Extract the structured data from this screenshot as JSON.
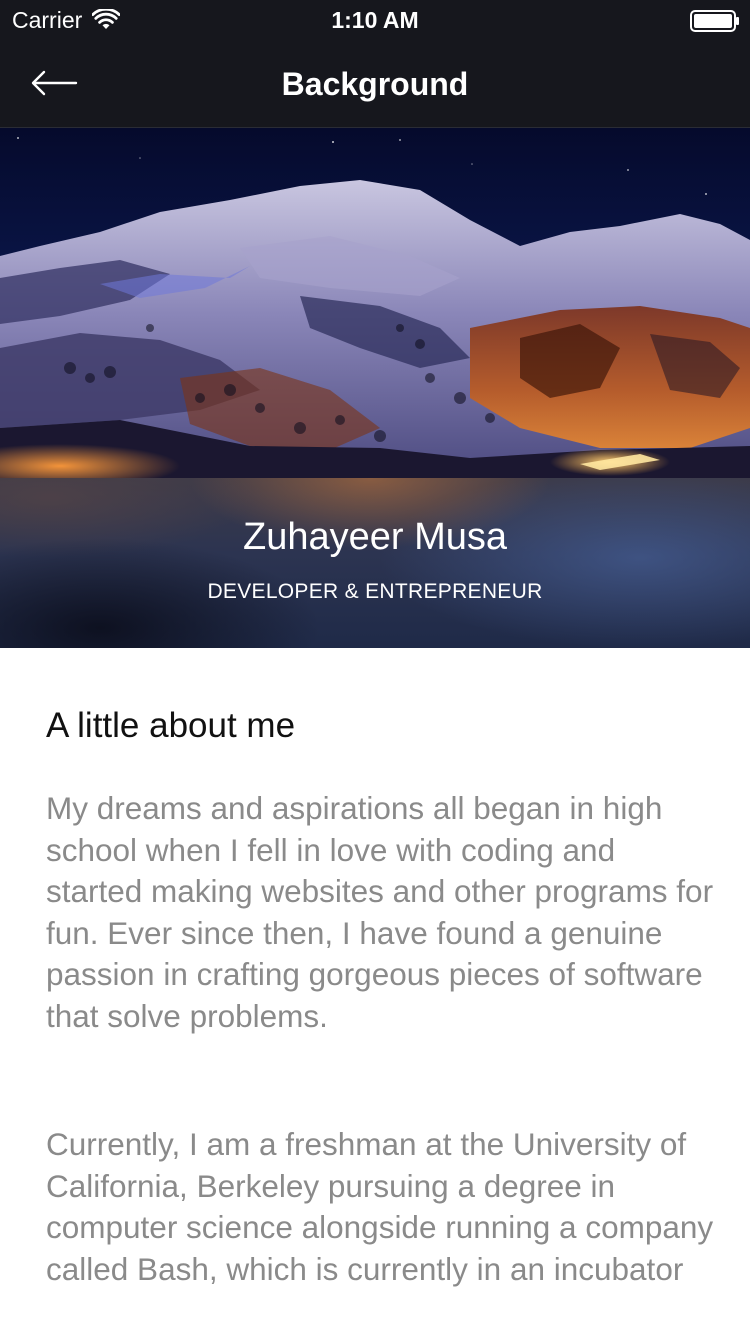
{
  "status_bar": {
    "carrier": "Carrier",
    "time": "1:10 AM"
  },
  "nav": {
    "title": "Background"
  },
  "profile": {
    "name": "Zuhayeer Musa",
    "role": "DEVELOPER & ENTREPRENEUR"
  },
  "about": {
    "heading": "A little about me",
    "paragraphs": [
      "My dreams and aspirations all began in high school when I fell in love with coding and started making websites and other programs for fun. Ever since then, I have found a genuine passion in crafting gorgeous pieces of software that solve problems.",
      "Currently, I am a freshman at the University of California, Berkeley pursuing a degree in computer science alongside running a company called Bash, which is currently in an incubator"
    ]
  },
  "icons": {
    "status_signal": "wifi-icon",
    "status_power": "battery-icon",
    "nav_back": "back-arrow-icon"
  },
  "colors": {
    "bar_background": "#16171d",
    "body_text": "#8a8a8a",
    "heading_text": "#111111"
  }
}
